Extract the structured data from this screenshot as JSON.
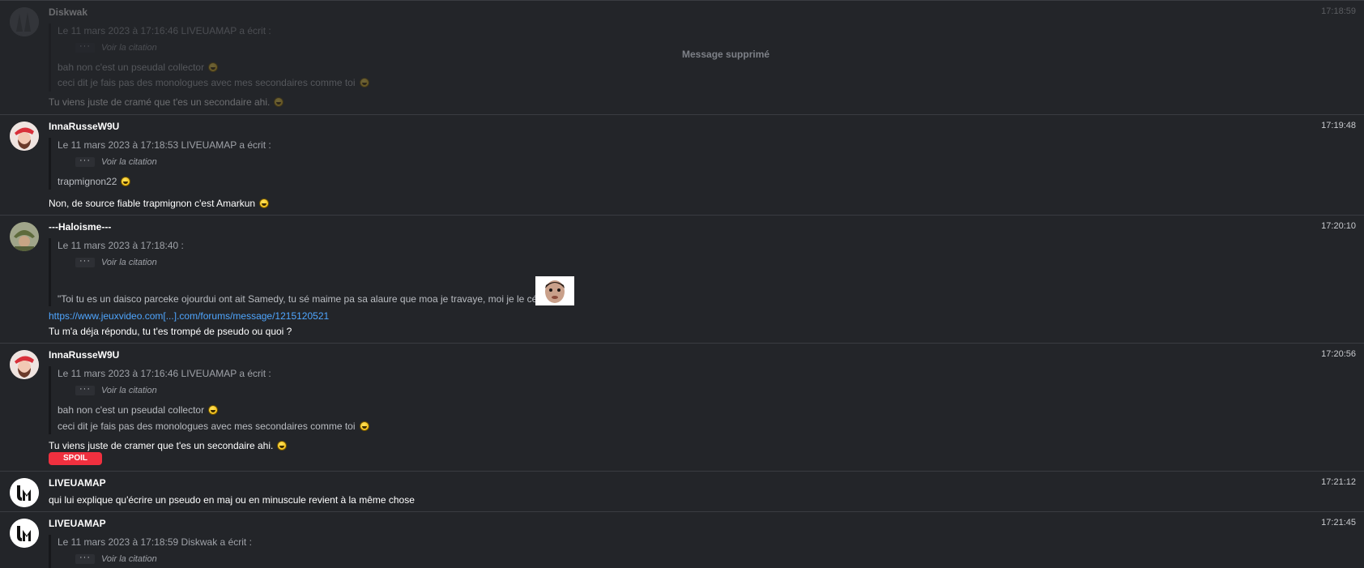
{
  "messages": [
    {
      "author": "Diskwak",
      "time": "17:18:59",
      "deleted_label": "Message supprimé",
      "quote_header": "Le 11 mars 2023 à 17:16:46 LIVEUAMAP a écrit :",
      "view_quote": "Voir la citation",
      "quote_lines": [
        "bah non c'est un pseudal collector",
        "ceci dit je fais pas des monologues avec mes secondaires comme toi"
      ],
      "lines": [
        "Tu viens juste de cramé que t'es un secondaire ahi."
      ]
    },
    {
      "author": "InnaRusseW9U",
      "time": "17:19:48",
      "quote_header": "Le 11 mars 2023 à 17:18:53 LIVEUAMAP a écrit :",
      "view_quote": "Voir la citation",
      "quote_lines": [
        "trapmignon22"
      ],
      "lines": [
        "Non, de source fiable trapmignon c'est Amarkun"
      ]
    },
    {
      "author": "---Haloisme---",
      "time": "17:20:10",
      "quote_header": "Le 11 mars 2023 à 17:18:40 :",
      "view_quote": "Voir la citation",
      "quote_lines": [
        "\"Toi tu es un daisco parceke ojourdui ont ait Samedy, tu sé maime pa sa alaure que moa je travaye, moi je le cé\""
      ],
      "link": "https://www.jeuxvideo.com[...].com/forums/message/1215120521",
      "lines": [
        "Tu m'a déja répondu, tu t'es trompé de pseudo ou quoi ?"
      ]
    },
    {
      "author": "InnaRusseW9U",
      "time": "17:20:56",
      "quote_header": "Le 11 mars 2023 à 17:16:46 LIVEUAMAP a écrit :",
      "view_quote": "Voir la citation",
      "quote_lines": [
        "bah non c'est un pseudal collector",
        "ceci dit je fais pas des monologues avec mes secondaires comme toi"
      ],
      "lines": [
        "Tu viens juste de cramer que t'es un secondaire ahi."
      ],
      "spoil_label": "SPOIL"
    },
    {
      "author": "LIVEUAMAP",
      "time": "17:21:12",
      "lines": [
        "qui lui explique qu'écrire un pseudo en maj ou en minuscule revient à la même chose"
      ]
    },
    {
      "author": "LIVEUAMAP",
      "time": "17:21:45",
      "quote_header": "Le 11 mars 2023 à 17:18:59 Diskwak a écrit :",
      "view_quote": "Voir la citation"
    }
  ],
  "colors": {
    "background": "#232529",
    "link": "#4fa6ff",
    "spoil": "#f0303f",
    "divider": "#3a3c41"
  },
  "icons": {
    "emoji": "smiley-icon",
    "sticker": "face-sticker-icon",
    "avatar_lm": "liveuamap-logo-icon"
  }
}
